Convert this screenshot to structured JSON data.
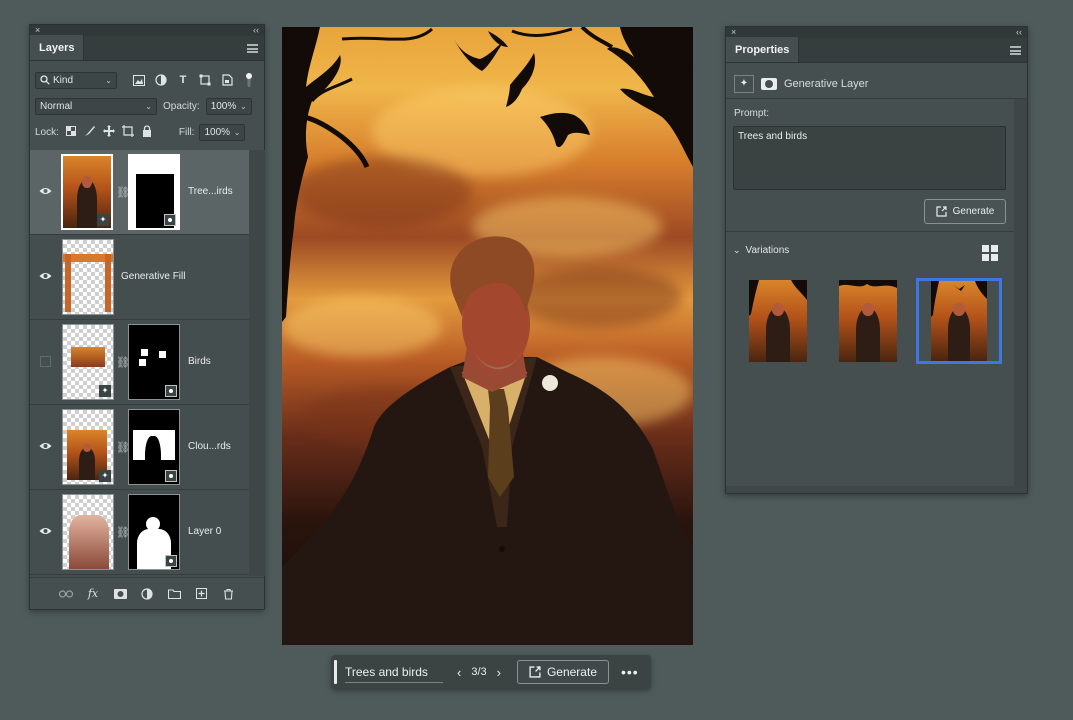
{
  "layers_panel": {
    "close_glyph": "×",
    "collapse_glyph": "‹‹",
    "tab_label": "Layers",
    "filter": {
      "search_glyph": "🔍",
      "kind_label": "Kind"
    },
    "blend_mode": "Normal",
    "opacity_label": "Opacity:",
    "opacity_value": "100%",
    "lock_label": "Lock:",
    "fill_label": "Fill:",
    "fill_value": "100%",
    "layers": [
      {
        "name": "Tree...irds",
        "visible": true,
        "selected": true
      },
      {
        "name": "Generative Fill",
        "visible": true,
        "selected": false
      },
      {
        "name": "Birds",
        "visible": false,
        "selected": false
      },
      {
        "name": "Clou...rds",
        "visible": true,
        "selected": false
      },
      {
        "name": "Layer 0",
        "visible": true,
        "selected": false
      }
    ]
  },
  "properties_panel": {
    "close_glyph": "×",
    "collapse_glyph": "‹‹",
    "tab_label": "Properties",
    "layer_type": "Generative Layer",
    "prompt_label": "Prompt:",
    "prompt_value": "Trees and birds",
    "generate_label": "Generate",
    "variations_label": "Variations",
    "variations_chevron": "⌄",
    "selected_variation": 3
  },
  "taskbar": {
    "prompt": "Trees and birds",
    "prev_glyph": "‹",
    "count": "3/3",
    "next_glyph": "›",
    "generate_label": "Generate",
    "more_glyph": "•••"
  },
  "colors": {
    "app_bg": "#4f5b5b",
    "panel_bg": "#464f4f",
    "selection_blue": "#3c78e0"
  }
}
